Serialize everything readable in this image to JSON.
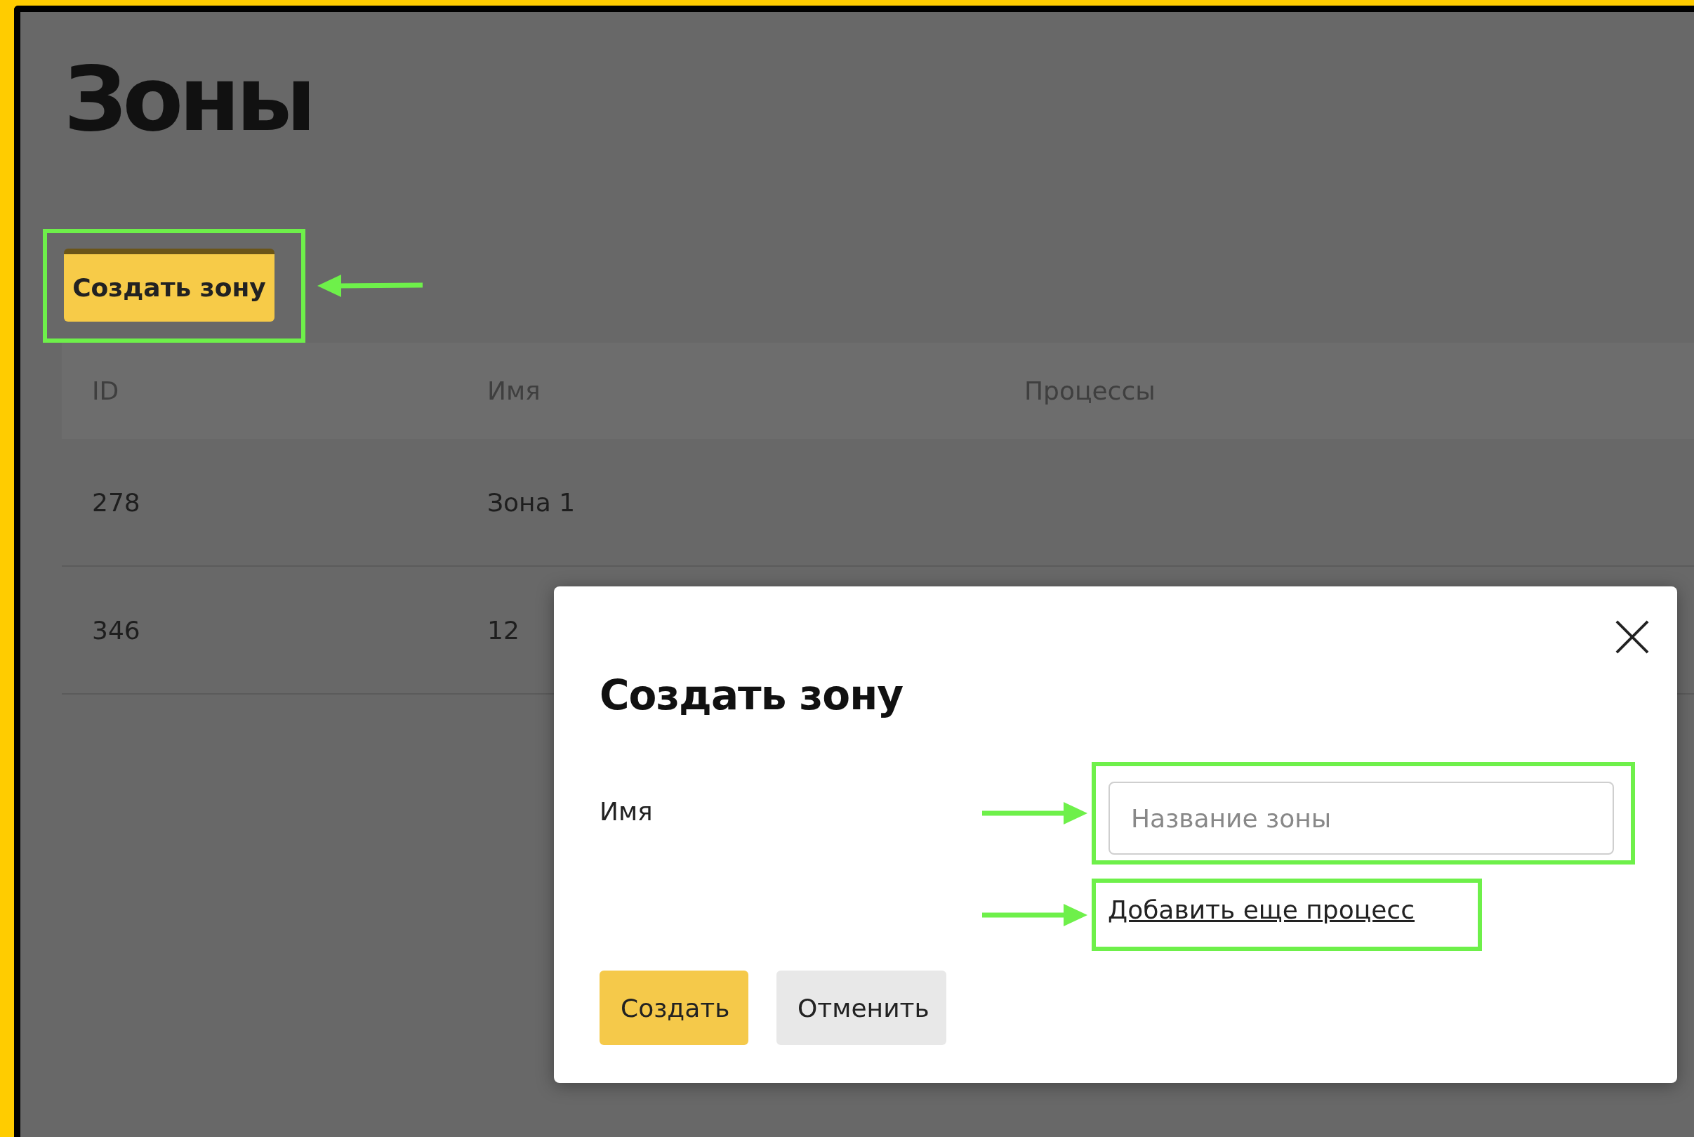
{
  "page": {
    "title": "Зоны"
  },
  "create_button": {
    "label": "Создать зону",
    "highlighted": true
  },
  "table": {
    "columns": [
      "ID",
      "Имя",
      "Процессы"
    ],
    "rows": [
      [
        "278",
        "Зона 1",
        ""
      ],
      [
        "346",
        "12",
        ""
      ]
    ]
  },
  "dialog": {
    "title": "Создать зону",
    "name_label": "Имя",
    "name_field": {
      "placeholder": "Название зоны",
      "highlighted": true
    },
    "add_link": {
      "label": "Добавить еще процесс",
      "highlighted": true
    },
    "buttons": [
      {
        "label": "Создать",
        "kind": "primary"
      },
      {
        "label": "Отменить",
        "kind": "secondary"
      }
    ]
  }
}
